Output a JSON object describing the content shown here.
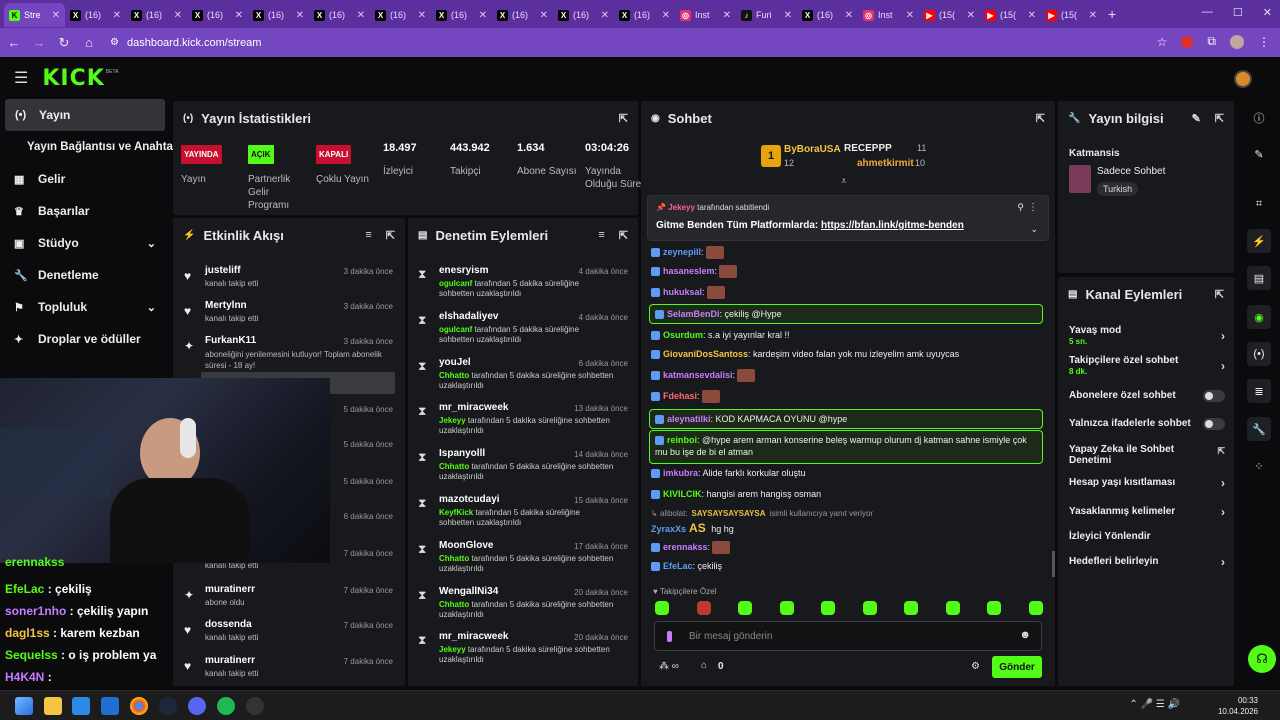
{
  "browser": {
    "tabs": [
      {
        "label": "Stre",
        "icon": "kick-icon",
        "active": true
      },
      {
        "label": "(16)",
        "icon": "x-icon"
      },
      {
        "label": "(16)",
        "icon": "x-icon"
      },
      {
        "label": "(16)",
        "icon": "x-icon"
      },
      {
        "label": "(16)",
        "icon": "x-icon"
      },
      {
        "label": "(16)",
        "icon": "x-icon"
      },
      {
        "label": "(16)",
        "icon": "x-icon"
      },
      {
        "label": "(16)",
        "icon": "x-icon"
      },
      {
        "label": "(16)",
        "icon": "x-icon"
      },
      {
        "label": "(16)",
        "icon": "x-icon"
      },
      {
        "label": "(16)",
        "icon": "x-icon"
      },
      {
        "label": "Inst",
        "icon": "instagram-icon"
      },
      {
        "label": "Furi",
        "icon": "tiktok-icon"
      },
      {
        "label": "(16)",
        "icon": "x-icon"
      },
      {
        "label": "Inst",
        "icon": "instagram-icon"
      },
      {
        "label": "(15(",
        "icon": "youtube-icon"
      },
      {
        "label": "(15(",
        "icon": "youtube-icon"
      },
      {
        "label": "(15(",
        "icon": "youtube-icon"
      }
    ],
    "url": "dashboard.kick.com/stream"
  },
  "sidebar": {
    "items": [
      {
        "label": "Yayın",
        "icon": "broadcast-icon"
      },
      {
        "label": "Yayın Bağlantısı ve Anahtarı",
        "icon": ""
      },
      {
        "label": "Gelir",
        "icon": "revenue-icon"
      },
      {
        "label": "Başarılar",
        "icon": "trophy-icon"
      },
      {
        "label": "Stüdyo",
        "icon": "studio-icon"
      },
      {
        "label": "Denetleme",
        "icon": "wrench-icon"
      },
      {
        "label": "Topluluk",
        "icon": "community-icon"
      },
      {
        "label": "Droplar ve ödüller",
        "icon": "drops-icon"
      }
    ]
  },
  "stats": {
    "title": "Yayın İstatistikleri",
    "items": [
      {
        "badge": "YAYINDA",
        "label": "Yayın"
      },
      {
        "badge": "AÇIK",
        "label": "Partnerlik Gelir Programı"
      },
      {
        "badge": "KAPALI",
        "label": "Çoklu Yayın"
      },
      {
        "value": "18.497",
        "label": "İzleyici"
      },
      {
        "value": "443.942",
        "label": "Takipçi"
      },
      {
        "value": "1.634",
        "label": "Abone Sayısı"
      },
      {
        "value": "03:04:26",
        "label": "Yayında Olduğu Süre"
      }
    ]
  },
  "activity": {
    "title": "Etkinlik Akışı",
    "rows": [
      {
        "name": "justeliff",
        "sub": "kanalı takip etti",
        "time": "3 dakika önce",
        "icon": "heart-icon"
      },
      {
        "name": "Mertylnn",
        "sub": "kanalı takip etti",
        "time": "3 dakika önce",
        "icon": "heart-icon"
      },
      {
        "name": "FurkanK11",
        "sub": "aboneliğini yenilemesini kutluyor! Toplam abonelik süresi - 18 ay!",
        "time": "3 dakika önce",
        "icon": "star-icon"
      },
      {
        "name": "",
        "sub": "",
        "time": "5 dakika önce",
        "icon": ""
      },
      {
        "name": "",
        "sub": "",
        "time": "5 dakika önce",
        "icon": ""
      },
      {
        "name": "",
        "sub": "",
        "time": "5 dakika önce",
        "icon": ""
      },
      {
        "name": "",
        "sub": "",
        "time": "6 dakika önce",
        "icon": ""
      },
      {
        "name": "",
        "sub": "kanalı takip etti",
        "time": "7 dakika önce",
        "icon": ""
      },
      {
        "name": "muratinerr",
        "sub": "abone oldu",
        "time": "7 dakika önce",
        "icon": "star-icon"
      },
      {
        "name": "dossenda",
        "sub": "kanalı takip etti",
        "time": "7 dakika önce",
        "icon": "heart-icon"
      },
      {
        "name": "muratinerr",
        "sub": "kanalı takip etti",
        "time": "7 dakika önce",
        "icon": "heart-icon"
      }
    ]
  },
  "moderation": {
    "title": "Denetim Eylemleri",
    "rows": [
      {
        "name": "enesryism",
        "time": "4 dakika önce",
        "mod": "ogulcanf",
        "text": " tarafından 5 dakika süreliğine sohbetten uzaklaştırıldı"
      },
      {
        "name": "elshadaliyev",
        "time": "4 dakika önce",
        "mod": "ogulcanf",
        "text": " tarafından 5 dakika süreliğine sohbetten uzaklaştırıldı"
      },
      {
        "name": "youJel",
        "time": "6 dakika önce",
        "mod": "Chhatto",
        "text": " tarafından 5 dakika süreliğine sohbetten uzaklaştırıldı"
      },
      {
        "name": "mr_miracweek",
        "time": "13 dakika önce",
        "mod": "Jekeyy",
        "text": " tarafından 5 dakika süreliğine sohbetten uzaklaştırıldı"
      },
      {
        "name": "Ispanyolll",
        "time": "14 dakika önce",
        "mod": "Chhatto",
        "text": " tarafından 5 dakika süreliğine sohbetten uzaklaştırıldı"
      },
      {
        "name": "mazotcudayi",
        "time": "15 dakika önce",
        "mod": "KeyfKick",
        "text": " tarafından 5 dakika süreliğine sohbetten uzaklaştırıldı"
      },
      {
        "name": "MoonGlove",
        "time": "17 dakika önce",
        "mod": "Chhatto",
        "text": " tarafından 5 dakika süreliğine sohbetten uzaklaştırıldı"
      },
      {
        "name": "WengallNi34",
        "time": "20 dakika önce",
        "mod": "Chhatto",
        "text": " tarafından 5 dakika süreliğine sohbetten uzaklaştırıldı"
      },
      {
        "name": "mr_miracweek",
        "time": "20 dakika önce",
        "mod": "Jekeyy",
        "text": " tarafından 5 dakika süreliğine sohbetten uzaklaştırıldı"
      }
    ]
  },
  "chat": {
    "title": "Sohbet",
    "top_gifters": [
      {
        "name": "ByBoraUSA",
        "count": "12"
      },
      {
        "name": "RECEPPP",
        "count": "11"
      },
      {
        "name": "ahmetkirmit",
        "count": "10"
      }
    ],
    "pinned": {
      "by": "Jekeyy",
      "by_text": "tarafından sabitlendi",
      "message": "Gitme Benden Tüm Platformlarda: ",
      "link": "https://bfan.link/gitme-benden"
    },
    "messages": [
      {
        "user": "zeynepill",
        "color": "#5d9cf5",
        "text": ":"
      },
      {
        "user": "hasaneslem",
        "color": "#c77dff",
        "text": ":"
      },
      {
        "user": "hukuksal",
        "color": "#c77dff",
        "text": ":"
      },
      {
        "user": "SelamBenDi",
        "color": "#c77dff",
        "text": ": çekiliş @Hype",
        "highlight": true
      },
      {
        "user": "Osurdum",
        "color": "#53fc18",
        "text": ": s.a iyi yayınlar kral !!"
      },
      {
        "user": "GiovaniDosSantoss",
        "color": "#f5c542",
        "text": ": kardeşim video falan yok mu izleyelim amk uyuycas"
      },
      {
        "user": "katmansevdalisi",
        "color": "#c77dff",
        "text": ":"
      },
      {
        "user": "Fdehasi",
        "color": "#ff6b6b",
        "text": ":"
      },
      {
        "user": "aleynatilki",
        "color": "#c77dff",
        "text": ": KOD KAPMACA OYUNU @hype",
        "highlight": true
      },
      {
        "user": "reinboi",
        "color": "#53fc18",
        "text": ": @hype arem arman konserine beleş warmup olurum dj katman sahne ismiyle çok mu bu işe de bi el atman",
        "highlight": true
      },
      {
        "user": "imkubra",
        "color": "#c77dff",
        "text": ": Alide farklı korkular oluştu"
      },
      {
        "user": "KIVILCIK",
        "color": "#53fc18",
        "text": ": hangisi arem hangisş osman"
      },
      {
        "user": "ZyraxXs",
        "color": "#5d9cf5",
        "text": " hg hg"
      },
      {
        "user": "erennakss",
        "color": "#c77dff",
        "text": ":"
      },
      {
        "user": "EfeLac",
        "color": "#5d9cf5",
        "text": ": çekiliş"
      }
    ],
    "reply_to": "alibolat:",
    "reply_note": "isimli kullanıcıya yanıt veriyor",
    "reply_emote_text": "SAYSAYSAYSAYSA",
    "reply_as": "AS",
    "follower_only": "Takipçilere Özel",
    "input_placeholder": "Bir mesaj gönderin",
    "points": "0",
    "send_label": "Gönder"
  },
  "stream_info": {
    "title": "Yayın bilgisi",
    "channel_title": "Katmansis",
    "category": "Sadece Sohbet",
    "tag": "Turkish"
  },
  "channel_actions": {
    "title": "Kanal Eylemleri",
    "rows": [
      {
        "label": "Yavaş mod",
        "sub": "5 sn.",
        "control": "chevron"
      },
      {
        "label": "Takipçilere özel sohbet",
        "sub": "8 dk.",
        "control": "chevron"
      },
      {
        "label": "Abonelere özel sohbet",
        "sub": "",
        "control": "toggle"
      },
      {
        "label": "Yalnızca ifadelerle sohbet",
        "sub": "",
        "control": "toggle"
      },
      {
        "label": "Yapay Zeka ile Sohbet Denetimi",
        "sub": "",
        "control": "external"
      },
      {
        "label": "Hesap yaşı kısıtlaması",
        "sub": "",
        "control": "chevron"
      },
      {
        "label": "Yasaklanmış kelimeler",
        "sub": "",
        "control": "chevron"
      },
      {
        "label": "İzleyici Yönlendir",
        "sub": "",
        "control": "none"
      },
      {
        "label": "Hedefleri belirleyin",
        "sub": "",
        "control": "chevron"
      }
    ]
  },
  "overlay_chat": [
    {
      "user": "erennakss",
      "text": "",
      "color": "#53fc18"
    },
    {
      "user": "EfeLac",
      "text": " : çekiliş",
      "color": "#53fc18"
    },
    {
      "user": "soner1nho",
      "text": " : çekiliş yapın",
      "color": "#c77dff"
    },
    {
      "user": "dagl1ss",
      "text": " : karem kezban",
      "color": "#f5c542"
    },
    {
      "user": "Sequelss",
      "text": " : o iş problem ya",
      "color": "#53fc18"
    },
    {
      "user": "H4K4N",
      "text": " :",
      "color": "#c77dff"
    }
  ],
  "taskbar": {
    "time": "00:33",
    "date": "10.04.2026"
  },
  "colors": {
    "kick_green": "#53fc18",
    "browser_purple": "#5b2f9e",
    "panel_bg": "#18191c"
  }
}
